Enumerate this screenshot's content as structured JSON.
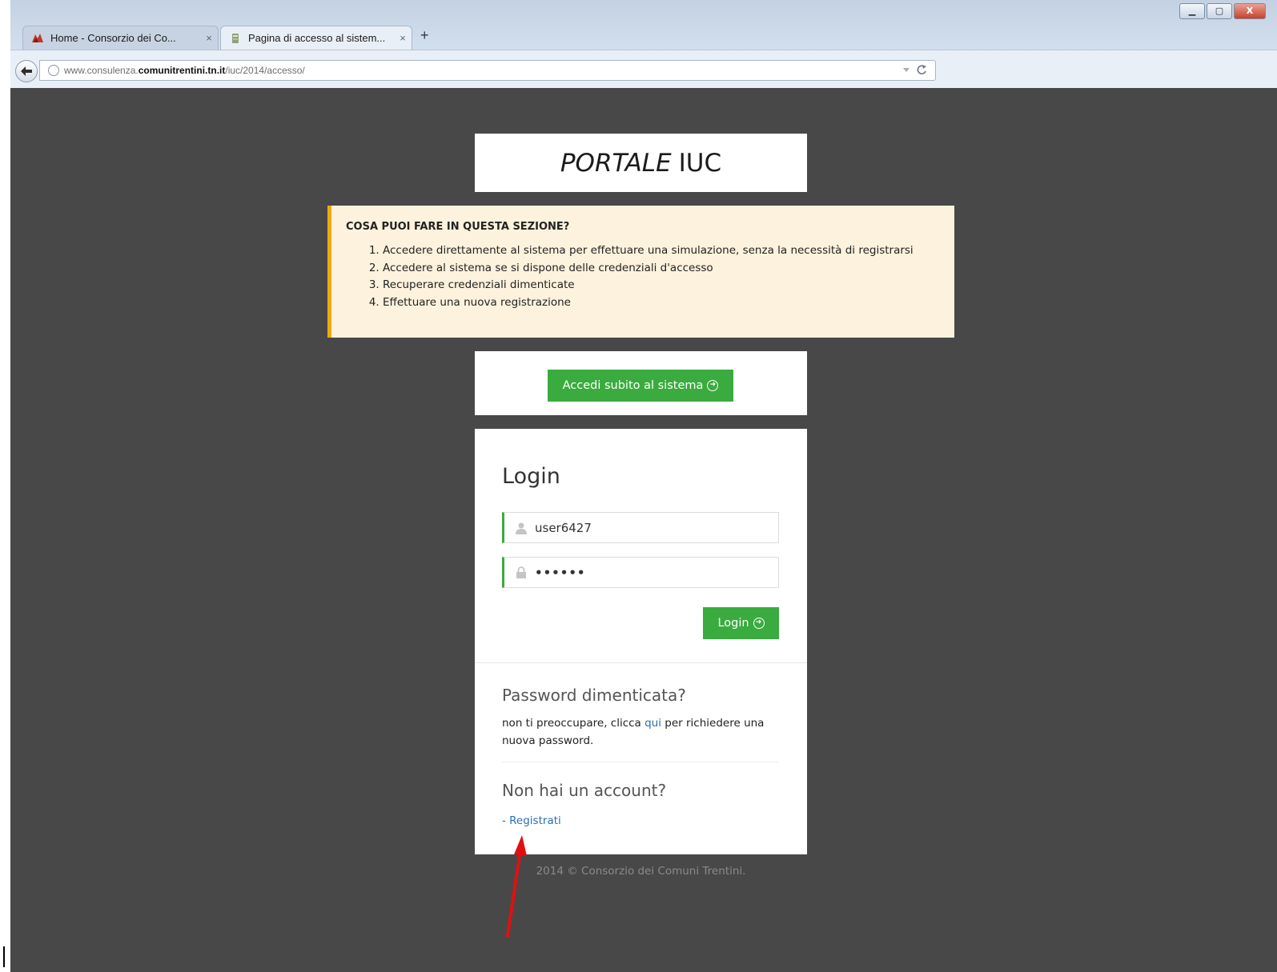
{
  "browser": {
    "tabs": [
      {
        "label": "Home - Consorzio dei Co...",
        "close": "×"
      },
      {
        "label": "Pagina di accesso al sistem...",
        "close": "×"
      }
    ],
    "new_tab": "+",
    "url": {
      "prefix": "www.consulenza.",
      "domain": "comunitrentini.tn.it",
      "path": "/iuc/2014/accesso/"
    },
    "window_buttons": [
      "▁",
      "▢",
      "X"
    ]
  },
  "portal": {
    "title_italic": "PORTALE",
    "title_rest": "IUC"
  },
  "info": {
    "heading": "COSA PUOI FARE IN QUESTA SEZIONE?",
    "items": [
      "Accedere direttamente al sistema per effettuare una simulazione, senza la necessità di registrarsi",
      "Accedere al sistema se si dispone delle credenziali d'accesso",
      "Recuperare credenziali dimenticate",
      "Effettuare una nuova registrazione"
    ]
  },
  "access": {
    "button_label": "Accedi subito al sistema"
  },
  "login": {
    "title": "Login",
    "username_value": "user6427",
    "password_value": "••••••",
    "button_label": "Login"
  },
  "forgot": {
    "title": "Password dimenticata?",
    "text_before": "non ti preoccupare, clicca ",
    "link": "qui",
    "text_after": " per richiedere una nuova password."
  },
  "register": {
    "title": "Non hai un account?",
    "link": "- Registrati"
  },
  "footer": {
    "text": "2014 © Consorzio dei Comuni Trentini."
  },
  "colors": {
    "page_bg": "#484848",
    "green": "#3aab3f",
    "notice_bg": "#fdf2dd",
    "notice_border": "#f0a814",
    "link": "#2a6fb8",
    "annotation_arrow": "#e01010"
  }
}
